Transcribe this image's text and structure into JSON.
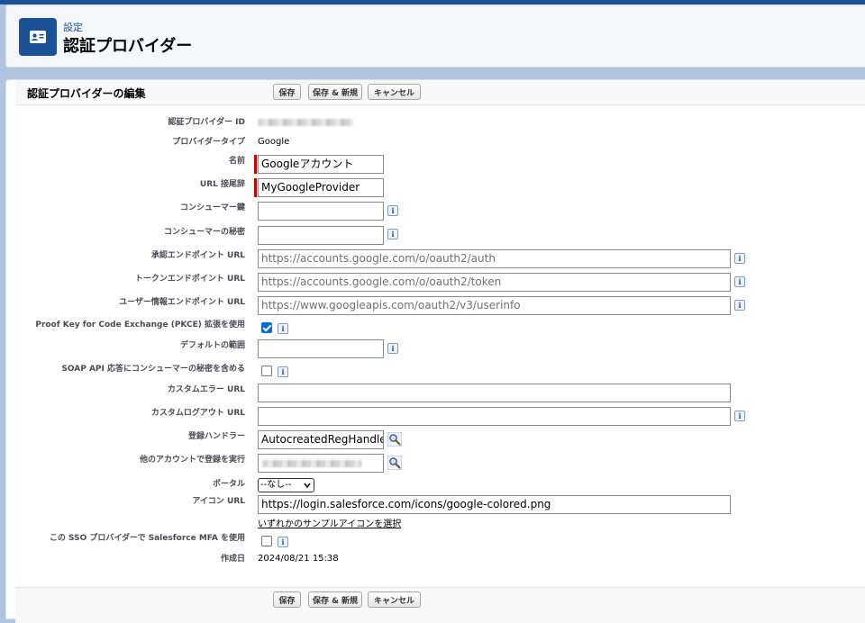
{
  "header": {
    "breadcrumb": "設定",
    "title": "認証プロバイダー",
    "icon": "contact-card-icon"
  },
  "section": {
    "title": "認証プロバイダーの編集",
    "buttons": {
      "save": "保存",
      "save_new": "保存 & 新規",
      "cancel": "キャンセル"
    }
  },
  "fields": {
    "provider_id": {
      "label": "認証プロバイダー ID"
    },
    "provider_type": {
      "label": "プロバイダータイプ",
      "value": "Google"
    },
    "name": {
      "label": "名前",
      "value": "Googleアカウント"
    },
    "url_suffix": {
      "label": "URL 接尾辞",
      "value": "MyGoogleProvider"
    },
    "consumer_key": {
      "label": "コンシューマー鍵",
      "value": ""
    },
    "consumer_secret": {
      "label": "コンシューマーの秘密",
      "value": ""
    },
    "authorize_url": {
      "label": "承認エンドポイント URL",
      "placeholder": "https://accounts.google.com/o/oauth2/auth"
    },
    "token_url": {
      "label": "トークンエンドポイント URL",
      "placeholder": "https://accounts.google.com/o/oauth2/token"
    },
    "userinfo_url": {
      "label": "ユーザー情報エンドポイント URL",
      "placeholder": "https://www.googleapis.com/oauth2/v3/userinfo"
    },
    "pkce": {
      "label": "Proof Key for Code Exchange (PKCE) 拡張を使用",
      "checked": true
    },
    "default_scopes": {
      "label": "デフォルトの範囲",
      "value": ""
    },
    "soap_secret": {
      "label": "SOAP API 応答にコンシューマーの秘密を含める",
      "checked": false
    },
    "custom_error_url": {
      "label": "カスタムエラー URL",
      "value": ""
    },
    "custom_logout_url": {
      "label": "カスタムログアウト URL",
      "value": ""
    },
    "reg_handler": {
      "label": "登録ハンドラー",
      "value": "AutocreatedRegHandle"
    },
    "execute_as": {
      "label": "他のアカウントで登録を実行"
    },
    "portal": {
      "label": "ポータル",
      "selected": "--なし--"
    },
    "icon_url": {
      "label": "アイコン URL",
      "value": "https://login.salesforce.com/icons/google-colored.png",
      "link": "いずれかのサンプルアイコンを選択"
    },
    "sso_mfa": {
      "label": "この SSO プロバイダーで Salesforce MFA を使用",
      "checked": false
    },
    "created_date": {
      "label": "作成日",
      "value": "2024/08/21 15:38"
    }
  },
  "colors": {
    "brand": "#1b5297",
    "required": "#cc0000",
    "checkbox": "#0b6bd6"
  }
}
